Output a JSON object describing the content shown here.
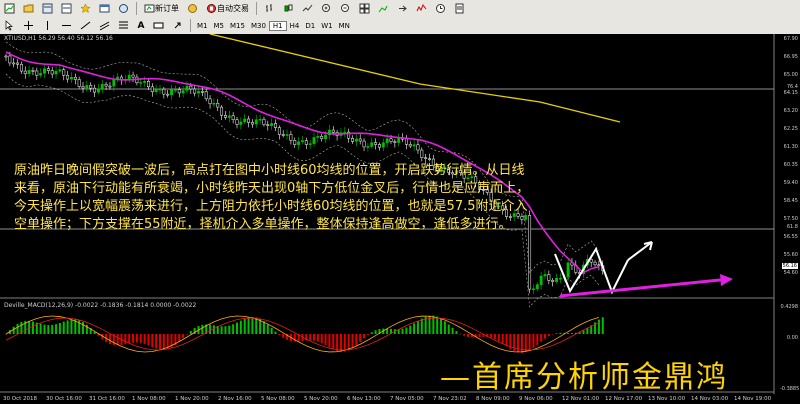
{
  "toolbar": {
    "new_order_label": "新订单",
    "autotrade_label": "自动交易",
    "timeframes": [
      "M1",
      "M5",
      "M15",
      "M30",
      "H1",
      "H4",
      "D1",
      "W1",
      "MN"
    ],
    "active_timeframe": "H1"
  },
  "chart": {
    "symbol_line": "XTIUSD,H1  56.29 56.40 56.12 56.16",
    "indicator_label": "Deville_MACD(12,26,9) -0.0022 -0.1836 -0.1814 0.0000 -0.0022",
    "price_labels": [
      "67.90",
      "66.95",
      "65.00",
      "64.15",
      "63.20",
      "62.25",
      "61.30",
      "60.35",
      "59.40",
      "58.45",
      "57.50",
      "56.55",
      "55.60",
      "54.60"
    ],
    "current_price": "56.16",
    "hline_upper_label": "76.4",
    "hline_lower_label": "61.8",
    "macd_labels": [
      "0.4298",
      "0.00",
      "-0.3885"
    ],
    "time_labels": [
      "30 Oct 2018",
      "30 Oct 16:00",
      "31 Oct 16:00",
      "1 Nov 08:00",
      "1 Nov 20:00",
      "2 Nov 16:00",
      "5 Nov 08:00",
      "5 Nov 20:00",
      "6 Nov 13:00",
      "7 Nov 05:00",
      "7 Nov 23:02",
      "8 Nov 09:00",
      "9 Nov 06:00",
      "12 Nov 01:00",
      "12 Nov 17:00",
      "13 Nov 10:00",
      "14 Nov 03:00",
      "14 Nov 19:00"
    ],
    "colors": {
      "ma60": "#e020e0",
      "ma_long": "#e8d000",
      "bull": "#00c000",
      "bear": "#ffffff",
      "arrow": "#e020e0",
      "text": "#ffe54a"
    }
  },
  "commentary": "原油昨日晚间假突破一波后，高点打在图中小时线60均线的位置，开启跌势行情。从日线来看，原油下行动能有所衰竭，小时线昨天出现0轴下方低位金叉后，行情也是应声而上，今天操作上以宽幅震荡来进行，上方阻力依托小时线60均线的位置，也就是57.5附近介入空单操作；下方支撑在55附近，择机介入多单操作，整体保持逢高做空，逢低多进行。",
  "signature": "—首席分析师金鼎鸿"
}
